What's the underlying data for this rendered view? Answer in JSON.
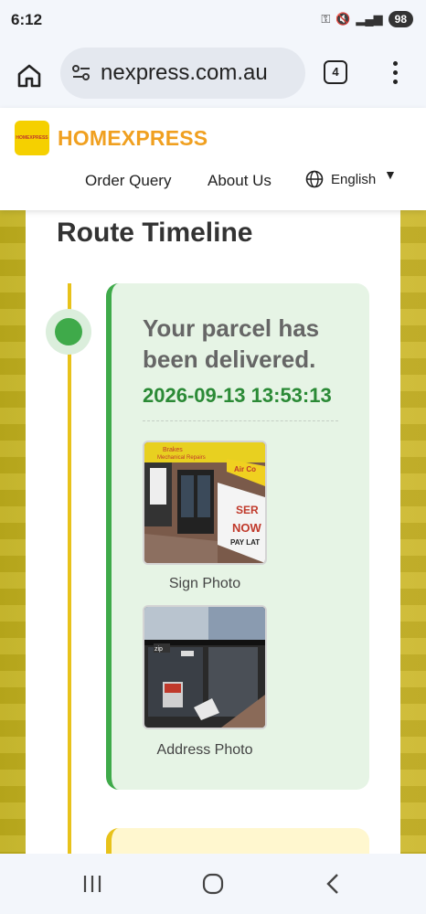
{
  "status": {
    "time": "6:12",
    "battery": "98"
  },
  "browser": {
    "url": "nexpress.com.au",
    "tab_count": "4"
  },
  "site": {
    "logo_text": "HOMEXPRESS",
    "brand": "HOMEXPRESS",
    "nav": {
      "order_query": "Order Query",
      "about_us": "About Us",
      "language": "English"
    }
  },
  "timeline": {
    "title": "Route Timeline",
    "events": [
      {
        "status": "Your parcel has been delivered.",
        "datetime": "2026-09-13 13:53:13",
        "photos": [
          {
            "label": "Sign Photo"
          },
          {
            "label": "Address Photo"
          }
        ]
      }
    ]
  },
  "colors": {
    "brand": "#f0a020",
    "delivered": "#3faa4a",
    "timeline": "#e8c21a"
  }
}
